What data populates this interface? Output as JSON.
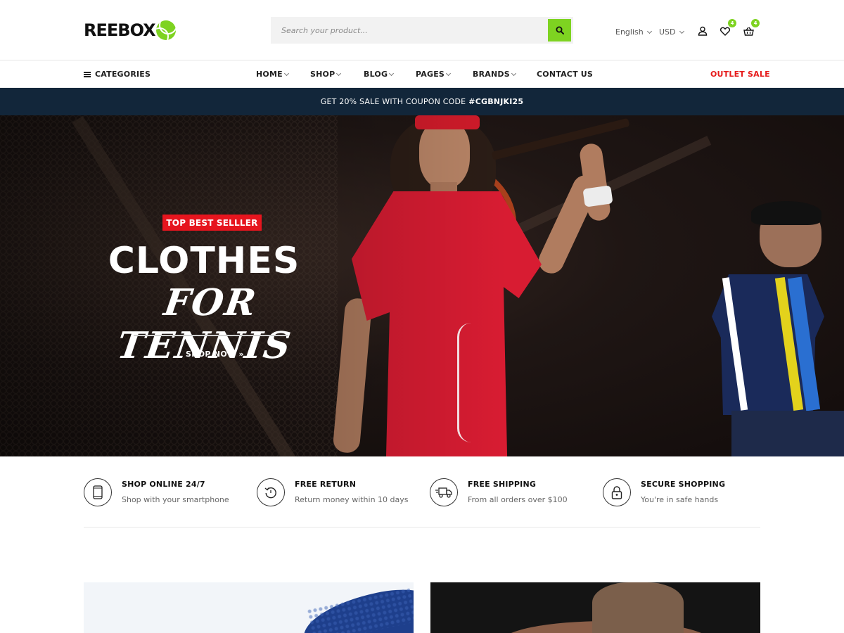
{
  "header": {
    "logo_text": "REEBOX",
    "search_placeholder": "Search your product...",
    "language": "English",
    "currency": "USD",
    "wishlist_count": "4",
    "cart_count": "4"
  },
  "nav": {
    "categories_label": "CATEGORIES",
    "items": [
      {
        "label": "HOME",
        "has_dropdown": true
      },
      {
        "label": "SHOP",
        "has_dropdown": true
      },
      {
        "label": "BLOG",
        "has_dropdown": true
      },
      {
        "label": "PAGES",
        "has_dropdown": true
      },
      {
        "label": "BRANDS",
        "has_dropdown": true
      },
      {
        "label": "CONTACT US",
        "has_dropdown": false
      }
    ],
    "outlet_label": "OUTLET SALE"
  },
  "promo": {
    "text": "GET 20% SALE WITH COUPON CODE",
    "code": "#CGBNJKI25"
  },
  "hero": {
    "badge": "TOP BEST SELLLER",
    "title_line1": "CLOTHES",
    "title_line2": "FOR TENNIS",
    "cta": "SHOP NOW"
  },
  "features": [
    {
      "icon": "smartphone-icon",
      "title": "SHOP ONLINE 24/7",
      "subtitle": "Shop with your smartphone"
    },
    {
      "icon": "return-icon",
      "title": "FREE RETURN",
      "subtitle": "Return money within 10 days"
    },
    {
      "icon": "truck-icon",
      "title": "FREE SHIPPING",
      "subtitle": "From all orders over $100"
    },
    {
      "icon": "lock-icon",
      "title": "SECURE SHOPPING",
      "subtitle": "You're in safe hands"
    }
  ],
  "colors": {
    "accent": "#7ed321",
    "promo_bg": "#12263a",
    "sale_red": "#e61b1b",
    "badge_red": "#e6151e"
  }
}
